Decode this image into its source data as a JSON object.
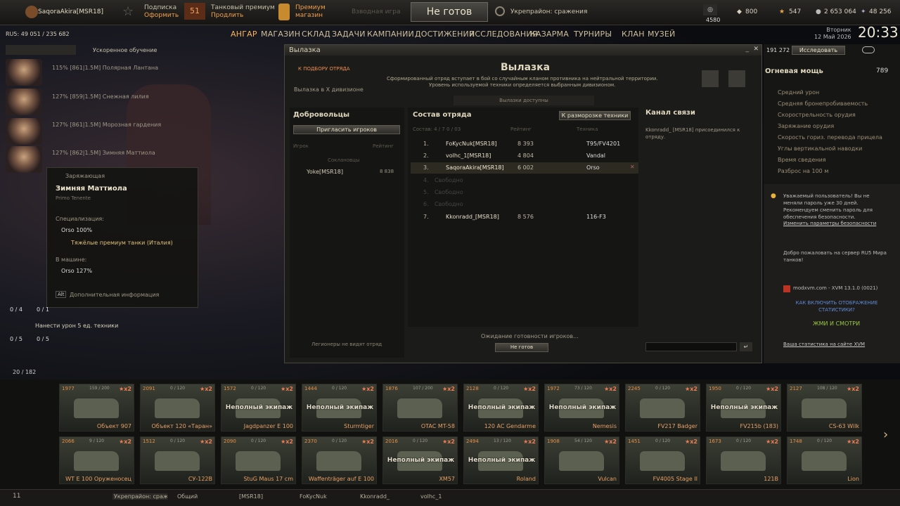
{
  "topbar": {
    "player": "SaqoraAkira[MSR18]",
    "sub": "Подписка",
    "sub_action": "Оформить",
    "premium_badge": "51",
    "tank_premium": "Танковый премиум",
    "tank_premium_action": "Продлить",
    "premium_shop": "Премиум магазин",
    "vzvod": "Взводная игра",
    "ready": "Не готов",
    "mode": "Укрепрайон: сражения",
    "online": "4580",
    "res_a": "800",
    "res_b": "547",
    "res_c": "2 653 064",
    "res_d": "48 256"
  },
  "nav": [
    "АНГАР",
    "МАГАЗИН",
    "СКЛАД",
    "ЗАДАЧИ",
    "КАМПАНИИ",
    "ДОСТИЖЕНИЯ",
    "ИССЛЕДОВАНИЯ",
    "КАЗАРМА",
    "ТУРНИРЫ",
    "КЛАН",
    "МУЗЕЙ"
  ],
  "server": "RU5: 49 051 / 235 682",
  "day": "Вторник",
  "date": "12 Май 2026",
  "time": "20:33",
  "accel": "Ускоренное обучение",
  "crew": [
    {
      "text": "115% [861|1.5M] Полярная Лантана"
    },
    {
      "text": "127% [859|1.5M] Снежная лилия"
    },
    {
      "text": "127% [861|1.5M] Морозная гардения"
    },
    {
      "text": "127% [862|1.5M] Зимняя Маттиола"
    }
  ],
  "tooltip": {
    "role": "Заряжающая",
    "name": "Зимняя Маттиола",
    "nation": "Primo Tenente",
    "spec_label": "Специализация:",
    "spec_tank": "Orso",
    "spec_pct": "100%",
    "spec_class": "Тяжёлые премиум танки (Италия)",
    "in_vehicle_label": "В машине:",
    "veh": "Orso",
    "veh_pct": "127%",
    "alt": "Alt",
    "more": "Дополнительная информация"
  },
  "missions": [
    {
      "count": "0 / 4"
    },
    {
      "count": "0 / 1"
    },
    {
      "text": "Нанести урон 5 ед. техники",
      "count": "0 / 5"
    }
  ],
  "window": {
    "title": "Вылазка",
    "header": "Вылазка",
    "back": "К ПОДБОРУ ОТРЯДА",
    "division": "Вылазка в X дивизионе",
    "desc1": "Сформированный отряд вступает в бой со случайным кланом противника на нейтральной территории.",
    "desc2": "Уровень используемой техники определяется выбранным дивизионом.",
    "available": "Вылазки доступны",
    "volunteers": "Добровольцы",
    "invite": "Пригласить игроков",
    "col_player": "Игрок",
    "col_rating": "Рейтинг",
    "soclan": "Соклановцы",
    "vol_name": "Yoke[MSR18]",
    "vol_rating": "8 838",
    "legion": "Легионеры не видят отряд",
    "squad": "Состав отряда",
    "unfreeze": "К разморозке техники",
    "squad_info": "Состав: 4 / 7",
    "squad_vehicles": "0 / 03",
    "col_rating2": "Рейтинг",
    "col_tech": "Техника",
    "waiting": "Ожидание готовности игроков...",
    "not_ready": "Не готов",
    "channel": "Канал связи",
    "channel_msg": "Kkonradd_ [MSR18] присоединился к отряду."
  },
  "squad_rows": [
    {
      "n": "1.",
      "name": "FoKycNuk[MSR18]",
      "rating": "8 393",
      "tank": "T95/FV4201"
    },
    {
      "n": "2.",
      "name": "volhc_1[MSR18]",
      "rating": "4 804",
      "tank": "Vandal"
    },
    {
      "n": "3.",
      "name": "SaqoraAkira[MSR18]",
      "rating": "6 002",
      "tank": "Orso"
    },
    {
      "n": "4.",
      "name": "Свободно",
      "rating": "",
      "tank": ""
    },
    {
      "n": "5.",
      "name": "Свободно",
      "rating": "",
      "tank": ""
    },
    {
      "n": "6.",
      "name": "Свободно",
      "rating": "",
      "tank": ""
    },
    {
      "n": "7.",
      "name": "Kkonradd_[MSR18]",
      "rating": "8 576",
      "tank": "116-F3"
    }
  ],
  "right": {
    "xp": "191 272",
    "research": "Исследовать",
    "firepower": "Огневая мощь",
    "fp_val": "789",
    "props": [
      "Средний урон",
      "Средняя бронепробиваемость",
      "Скорострельность орудия",
      "Заряжание орудия",
      "Скорость гориз. перевода прицела",
      "Углы вертикальной наводки",
      "Время сведения",
      "Разброс на 100 м"
    ],
    "warn": "Уважаемый пользователь! Вы не меняли пароль уже 30 дней. Рекомендуем сменить пароль для обеспечения безопасности.",
    "warn_link": "Изменить параметры безопасности",
    "welcome": "Добро пожаловать на сервер RU5 Мира танков!",
    "xvm": "modxvm.com - XVM 13.1.0 (0021)",
    "xvm_stat": "КАК ВКЛЮЧИТЬ ОТОБРАЖЕНИЕ СТАТИСТИКИ?",
    "xvm_watch": "ЖМИ И СМОТРИ",
    "xvm_site": "Ваша статистика на сайте XVM"
  },
  "hangar_count": "20 / 182",
  "tanks": [
    {
      "name": "Объект 907",
      "lv": "1977",
      "cnt": "159 / 200",
      "crew": ""
    },
    {
      "name": "Объект 120 «Таран»",
      "lv": "2091",
      "cnt": "0 / 120",
      "crew": ""
    },
    {
      "name": "Jagdpanzer E 100",
      "lv": "1572",
      "cnt": "0 / 120",
      "crew": "Неполный экипаж"
    },
    {
      "name": "Sturmtiger",
      "lv": "1444",
      "cnt": "0 / 120",
      "crew": "Неполный экипаж"
    },
    {
      "name": "OTAC MT-58",
      "lv": "1876",
      "cnt": "107 / 200",
      "crew": ""
    },
    {
      "name": "120 AC Gendarme",
      "lv": "2128",
      "cnt": "0 / 120",
      "crew": "Неполный экипаж"
    },
    {
      "name": "Nemesis",
      "lv": "1972",
      "cnt": "73 / 120",
      "crew": "Неполный экипаж"
    },
    {
      "name": "FV217 Badger",
      "lv": "2245",
      "cnt": "0 / 120",
      "crew": ""
    },
    {
      "name": "FV215b (183)",
      "lv": "1950",
      "cnt": "0 / 120",
      "crew": "Неполный экипаж"
    },
    {
      "name": "CS-63 Wilk",
      "lv": "2127",
      "cnt": "108 / 120",
      "crew": ""
    },
    {
      "name": "WT E 100 Оруженосец",
      "lv": "2066",
      "cnt": "9 / 120",
      "crew": ""
    },
    {
      "name": "СУ-122В",
      "lv": "1512",
      "cnt": "0 / 120",
      "crew": ""
    },
    {
      "name": "StuG Maus 17 cm",
      "lv": "2090",
      "cnt": "0 / 120",
      "crew": ""
    },
    {
      "name": "Waffenträger auf E 100",
      "lv": "2370",
      "cnt": "0 / 120",
      "crew": ""
    },
    {
      "name": "XM57",
      "lv": "2016",
      "cnt": "0 / 120",
      "crew": "Неполный экипаж"
    },
    {
      "name": "Roland",
      "lv": "2494",
      "cnt": "13 / 120",
      "crew": "Неполный экипаж"
    },
    {
      "name": "Vulcan",
      "lv": "1908",
      "cnt": "54 / 120",
      "crew": ""
    },
    {
      "name": "FV4005 Stage II",
      "lv": "1451",
      "cnt": "0 / 120",
      "crew": ""
    },
    {
      "name": "121B",
      "lv": "1673",
      "cnt": "0 / 120",
      "crew": ""
    },
    {
      "name": "Lion",
      "lv": "1748",
      "cnt": "0 / 120",
      "crew": ""
    }
  ],
  "taskbar": [
    "11",
    "Укрепрайон: сражен...",
    "Общий",
    "[MSR18]",
    "FoKycNuk",
    "Kkonradd_",
    "volhc_1"
  ]
}
